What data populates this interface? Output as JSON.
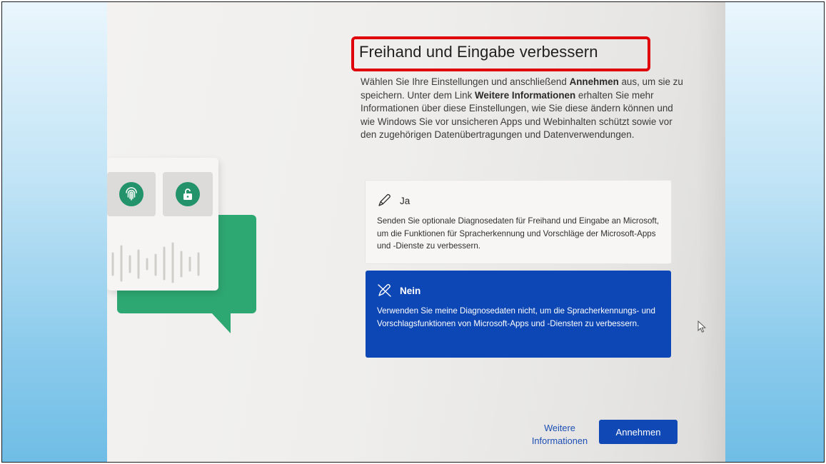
{
  "page": {
    "title": "Freihand und Eingabe verbessern",
    "description": [
      {
        "text": "Wählen Sie Ihre Einstellungen und anschließend ",
        "bold": false
      },
      {
        "text": "Annehmen",
        "bold": true
      },
      {
        "text": " aus, um sie zu speichern. Unter dem Link ",
        "bold": false
      },
      {
        "text": "Weitere Informationen",
        "bold": true
      },
      {
        "text": " erhalten Sie mehr Informationen über diese Einstellungen, wie Sie diese ändern können und wie Windows Sie vor unsicheren Apps und Webinhalten schützt sowie vor den zugehörigen Datenübertragungen und Datenverwendungen.",
        "bold": false
      }
    ]
  },
  "options": [
    {
      "label": "Ja",
      "icon": "pen-icon",
      "selected": false,
      "text": "Senden Sie optionale Diagnosedaten für Freihand und Eingabe an Microsoft, um die Funktionen für Spracherkennung und Vorschläge der Microsoft-Apps und -Dienste zu verbessern."
    },
    {
      "label": "Nein",
      "icon": "pen-crossed-icon",
      "selected": true,
      "text": "Verwenden Sie meine Diagnosedaten nicht, um die Spracherkennungs- und Vorschlagsfunktionen von Microsoft-Apps und -Diensten zu verbessern."
    }
  ],
  "footer": {
    "more_info_label": "Weitere Informationen",
    "accept_label": "Annehmen"
  },
  "illustration": {
    "icons": [
      "fingerprint-icon",
      "unlock-icon",
      "sound-wave-icon",
      "speech-bubble-icon"
    ]
  },
  "colors": {
    "accent": "#0d47b5",
    "highlight_box": "#e0000a",
    "illustration_green": "#2ea873"
  }
}
